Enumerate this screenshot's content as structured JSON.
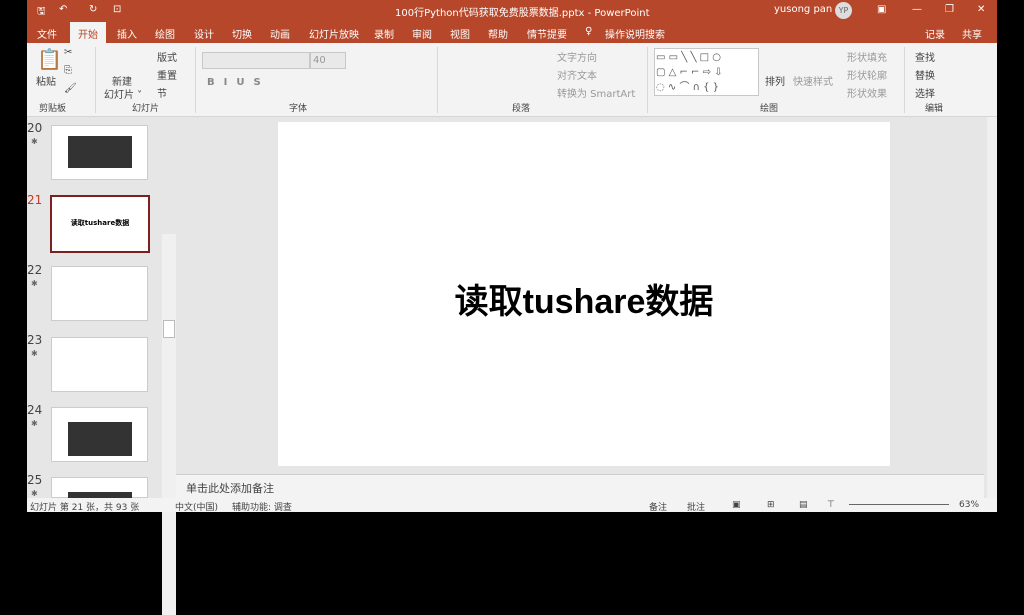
{
  "title": "100行Python代码获取免费股票数据.pptx - PowerPoint",
  "user": "yusong pan",
  "avatar": "YP",
  "tabs": [
    "文件",
    "开始",
    "插入",
    "绘图",
    "设计",
    "切换",
    "动画",
    "幻灯片放映",
    "录制",
    "审阅",
    "视图",
    "帮助",
    "情节提要"
  ],
  "search": "操作说明搜索",
  "record": "记录",
  "share": "共享",
  "ribbon": {
    "paste": "粘贴",
    "clipboard": "剪贴板",
    "new_slide": "新建",
    "new_slide2": "幻灯片 ˅",
    "layout": "版式",
    "reset": "重置",
    "section": "节",
    "slides": "幻灯片",
    "font_size": "40",
    "font": "字体",
    "paragraph": "段落",
    "text_dir": "文字方向",
    "align_text": "对齐文本",
    "smartart": "转换为 SmartArt",
    "arrange": "排列",
    "quick_styles": "快速样式",
    "fill": "形状填充",
    "outline": "形状轮廓",
    "effects": "形状效果",
    "drawing": "绘图",
    "find": "查找",
    "replace": "替换",
    "select": "选择",
    "editing": "编辑"
  },
  "slides": [
    {
      "n": "20"
    },
    {
      "n": "21"
    },
    {
      "n": "22"
    },
    {
      "n": "23"
    },
    {
      "n": "24"
    },
    {
      "n": "25"
    }
  ],
  "thumb21": "读取tushare数据",
  "slide_title": "读取tushare数据",
  "notes": "单击此处添加备注",
  "status": {
    "count": "幻灯片 第 21 张，共 93 张",
    "lang": "中文(中国)",
    "access": "辅助功能: 调查",
    "notes": "备注",
    "comments": "批注",
    "zoom": "63%"
  }
}
